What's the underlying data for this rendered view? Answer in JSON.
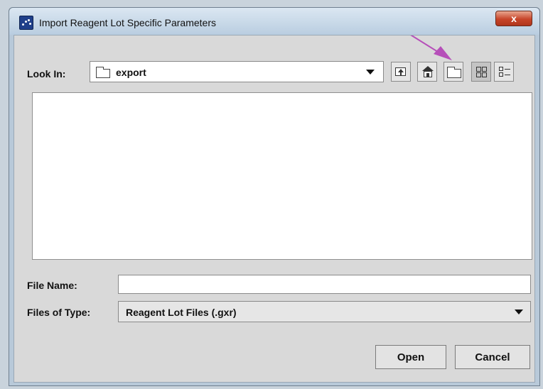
{
  "window": {
    "title": "Import Reagent Lot Specific Parameters",
    "close_label": "x"
  },
  "look_in": {
    "label": "Look In:",
    "value": "export",
    "folder_icon": "folder-icon"
  },
  "toolbar": {
    "icons": [
      "up-one-level-icon",
      "home-icon",
      "new-folder-icon",
      "list-view-icon",
      "details-view-icon"
    ],
    "active_view": "list-view"
  },
  "file_name": {
    "label": "File Name:",
    "value": "",
    "placeholder": ""
  },
  "files_of_type": {
    "label": "Files of Type:",
    "value": "Reagent Lot Files (.gxr)"
  },
  "buttons": {
    "open": "Open",
    "cancel": "Cancel"
  },
  "annotation": {
    "arrow_color": "#b64fb9",
    "target": "new-folder-icon"
  },
  "colors": {
    "title_bar": "#c9d9e8",
    "dialog_bg": "#d9d9d9",
    "close_button": "#c7452a"
  }
}
